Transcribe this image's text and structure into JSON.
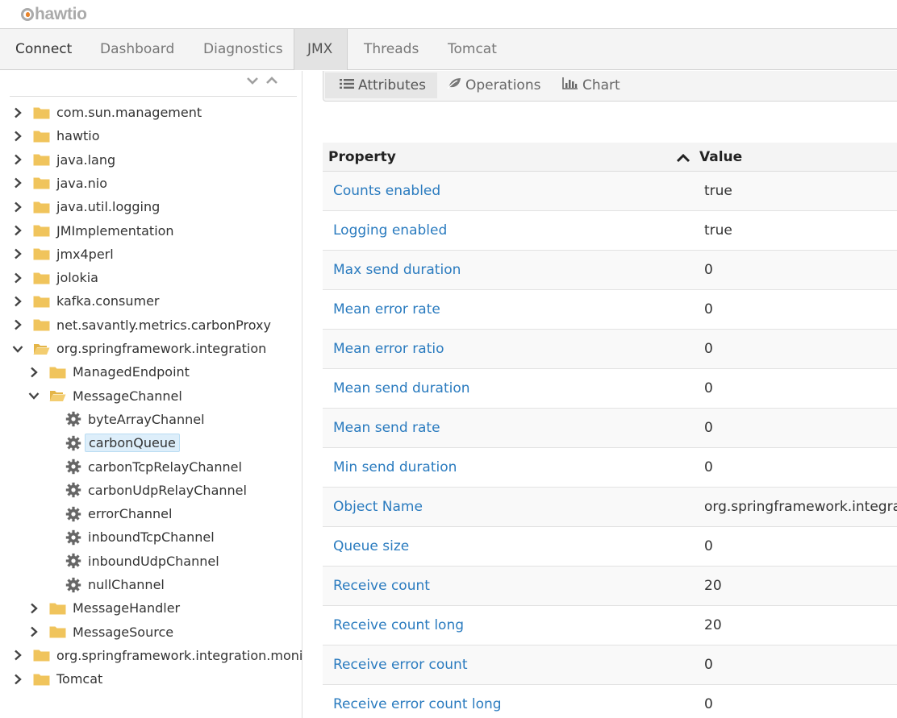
{
  "app": {
    "logo_text": "hawtio"
  },
  "nav": {
    "tabs": [
      {
        "label": "Connect"
      },
      {
        "label": "Dashboard"
      },
      {
        "label": "Diagnostics"
      },
      {
        "label": "JMX"
      },
      {
        "label": "Threads"
      },
      {
        "label": "Tomcat"
      }
    ],
    "active": "JMX"
  },
  "tree": {
    "collapse_icons": [
      "chevron-down-icon",
      "chevron-up-icon"
    ],
    "nodes": [
      {
        "label": "com.sun.management",
        "type": "folder",
        "expanded": false
      },
      {
        "label": "hawtio",
        "type": "folder",
        "expanded": false
      },
      {
        "label": "java.lang",
        "type": "folder",
        "expanded": false
      },
      {
        "label": "java.nio",
        "type": "folder",
        "expanded": false
      },
      {
        "label": "java.util.logging",
        "type": "folder",
        "expanded": false
      },
      {
        "label": "JMImplementation",
        "type": "folder",
        "expanded": false
      },
      {
        "label": "jmx4perl",
        "type": "folder",
        "expanded": false
      },
      {
        "label": "jolokia",
        "type": "folder",
        "expanded": false
      },
      {
        "label": "kafka.consumer",
        "type": "folder",
        "expanded": false
      },
      {
        "label": "net.savantly.metrics.carbonProxy",
        "type": "folder",
        "expanded": false
      },
      {
        "label": "org.springframework.integration",
        "type": "folder",
        "expanded": true
      },
      {
        "label": "ManagedEndpoint",
        "type": "folder",
        "expanded": false
      },
      {
        "label": "MessageChannel",
        "type": "folder",
        "expanded": true
      },
      {
        "label": "byteArrayChannel",
        "type": "leaf"
      },
      {
        "label": "carbonQueue",
        "type": "leaf",
        "selected": true
      },
      {
        "label": "carbonTcpRelayChannel",
        "type": "leaf"
      },
      {
        "label": "carbonUdpRelayChannel",
        "type": "leaf"
      },
      {
        "label": "errorChannel",
        "type": "leaf"
      },
      {
        "label": "inboundTcpChannel",
        "type": "leaf"
      },
      {
        "label": "inboundUdpChannel",
        "type": "leaf"
      },
      {
        "label": "nullChannel",
        "type": "leaf"
      },
      {
        "label": "MessageHandler",
        "type": "folder",
        "expanded": false
      },
      {
        "label": "MessageSource",
        "type": "folder",
        "expanded": false
      },
      {
        "label": "org.springframework.integration.moni",
        "type": "folder",
        "expanded": false
      },
      {
        "label": "Tomcat",
        "type": "folder",
        "expanded": false
      }
    ]
  },
  "sub_tabs": [
    {
      "label": "Attributes",
      "icon": "list-icon"
    },
    {
      "label": "Operations",
      "icon": "leaf-icon"
    },
    {
      "label": "Chart",
      "icon": "bar-chart-icon"
    }
  ],
  "attributes_table": {
    "headers": {
      "property": "Property",
      "value": "Value"
    },
    "sort_icon": "chevron-up-icon",
    "rows": [
      {
        "property": "Counts enabled",
        "value": "true"
      },
      {
        "property": "Logging enabled",
        "value": "true"
      },
      {
        "property": "Max send duration",
        "value": "0"
      },
      {
        "property": "Mean error rate",
        "value": "0"
      },
      {
        "property": "Mean error ratio",
        "value": "0"
      },
      {
        "property": "Mean send duration",
        "value": "0"
      },
      {
        "property": "Mean send rate",
        "value": "0"
      },
      {
        "property": "Min send duration",
        "value": "0"
      },
      {
        "property": "Object Name",
        "value": "org.springframework.integrat"
      },
      {
        "property": "Queue size",
        "value": "0"
      },
      {
        "property": "Receive count",
        "value": "20"
      },
      {
        "property": "Receive count long",
        "value": "20"
      },
      {
        "property": "Receive error count",
        "value": "0"
      },
      {
        "property": "Receive error count long",
        "value": "0"
      }
    ]
  },
  "colors": {
    "link": "#2a7bbf",
    "folder": "#f0c45c",
    "selected_bg": "#ddeefa",
    "logo_accent": "#e8832a"
  }
}
